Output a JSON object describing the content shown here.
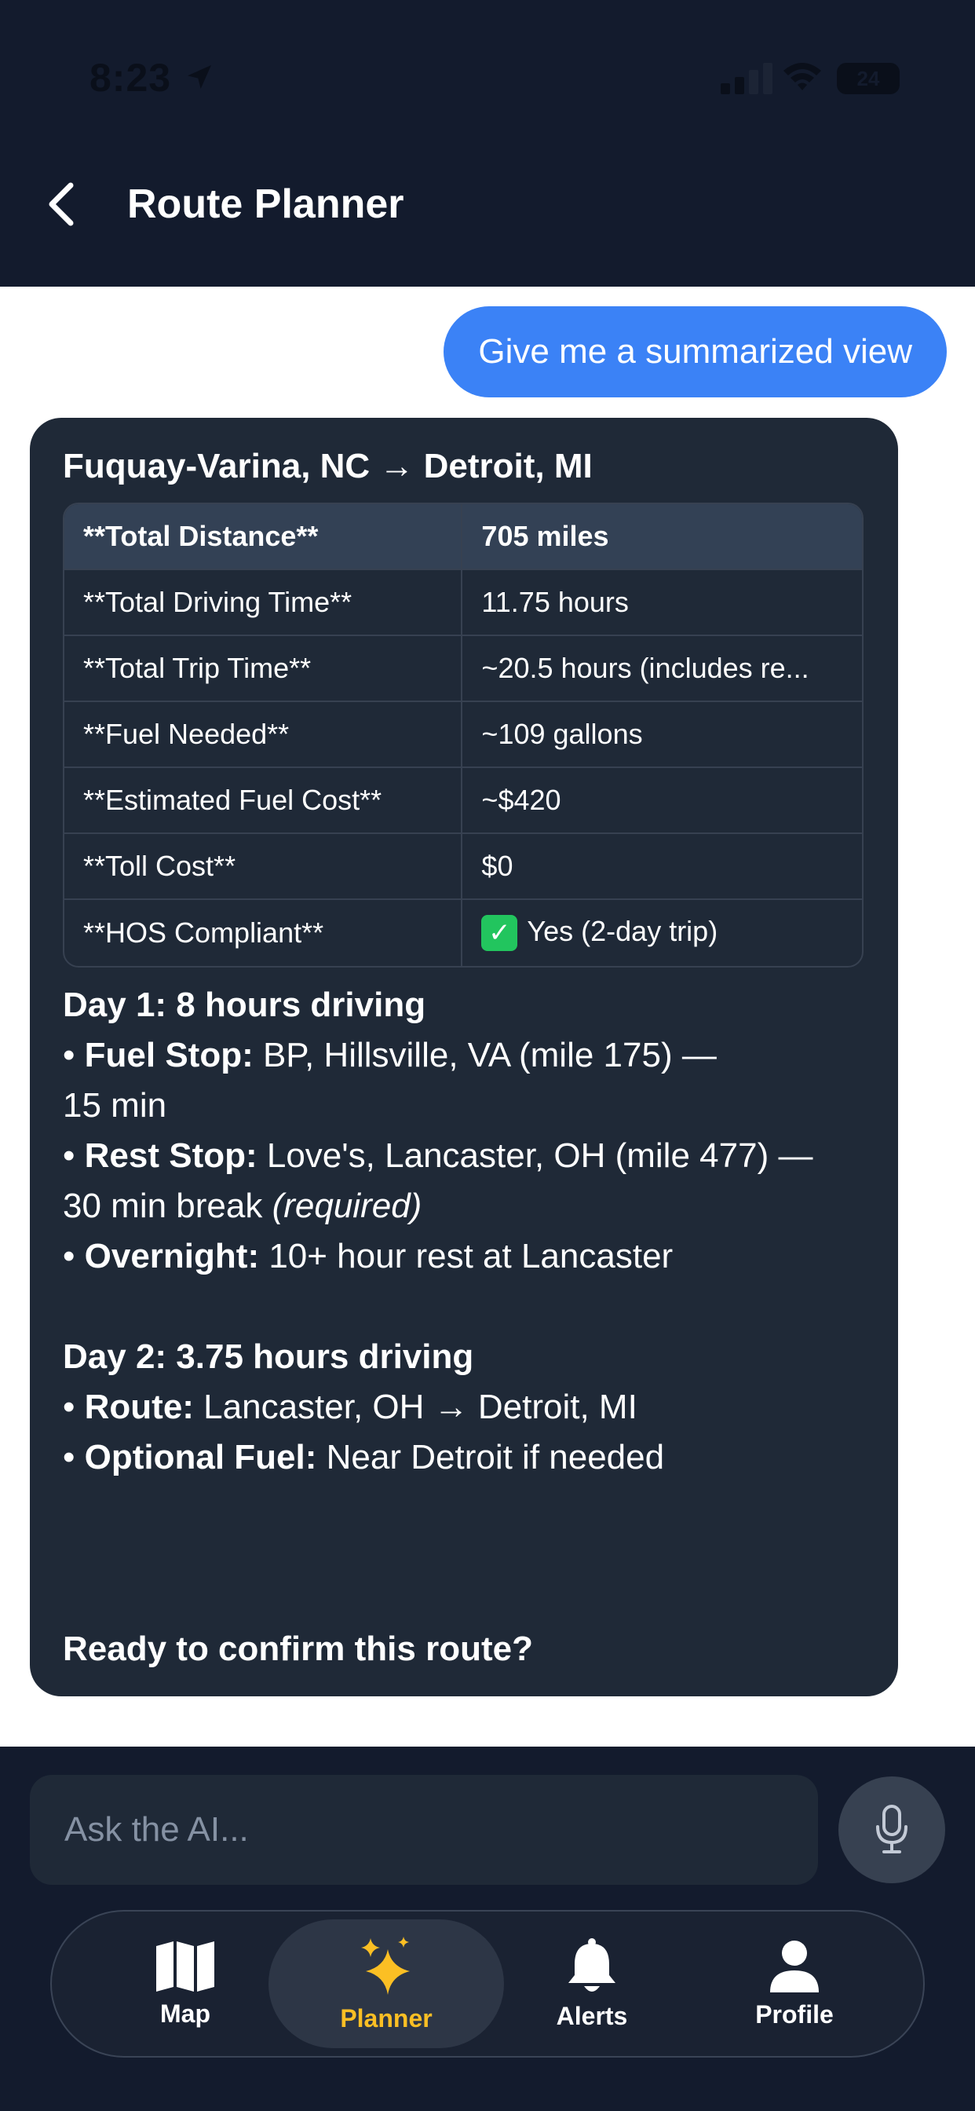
{
  "status_bar": {
    "time": "8:23",
    "battery": "24"
  },
  "header": {
    "title": "Route Planner"
  },
  "chat": {
    "user_message": "Give me a summarized view",
    "ai": {
      "route_title": "Fuquay-Varina, NC → Detroit, MI",
      "table": {
        "header": {
          "key": "**Total Distance**",
          "value": "705 miles"
        },
        "rows": [
          {
            "key": "**Total Driving Time**",
            "value": "11.75 hours"
          },
          {
            "key": "**Total Trip Time**",
            "value": "~20.5 hours (includes re..."
          },
          {
            "key": "**Fuel Needed**",
            "value": "~109 gallons"
          },
          {
            "key": "**Estimated Fuel Cost**",
            "value": "~$420"
          },
          {
            "key": "**Toll Cost**",
            "value": "$0"
          },
          {
            "key": "**HOS Compliant**",
            "value": "Yes (2-day trip)"
          }
        ]
      },
      "day1": {
        "title": "Day 1: 8 hours driving",
        "fuel_label": "Fuel Stop:",
        "fuel_text": " BP, Hillsville, VA (mile 175) —",
        "fuel_text_2": "15 min",
        "rest_label": "Rest Stop:",
        "rest_text": " Love's, Lancaster, OH (mile 477) —",
        "rest_text_2": "30 min break ",
        "rest_required": "(required)",
        "overnight_label": "Overnight:",
        "overnight_text": " 10+ hour rest at Lancaster"
      },
      "day2": {
        "title": "Day 2: 3.75 hours driving",
        "route_label": "Route:",
        "route_text": " Lancaster, OH → Detroit, MI",
        "fuel_label": "Optional Fuel:",
        "fuel_text": " Near Detroit if needed"
      },
      "confirm": "Ready to confirm this route?"
    }
  },
  "input": {
    "placeholder": "Ask the AI..."
  },
  "tabs": [
    {
      "label": "Map",
      "icon": "map-icon"
    },
    {
      "label": "Planner",
      "icon": "sparkles-icon"
    },
    {
      "label": "Alerts",
      "icon": "bell-icon"
    },
    {
      "label": "Profile",
      "icon": "person-icon"
    }
  ],
  "colors": {
    "header_bg": "#131b2d",
    "accent_blue": "#3b82f6",
    "active_tab": "#fbbf24",
    "card_bg": "#1f2937"
  }
}
